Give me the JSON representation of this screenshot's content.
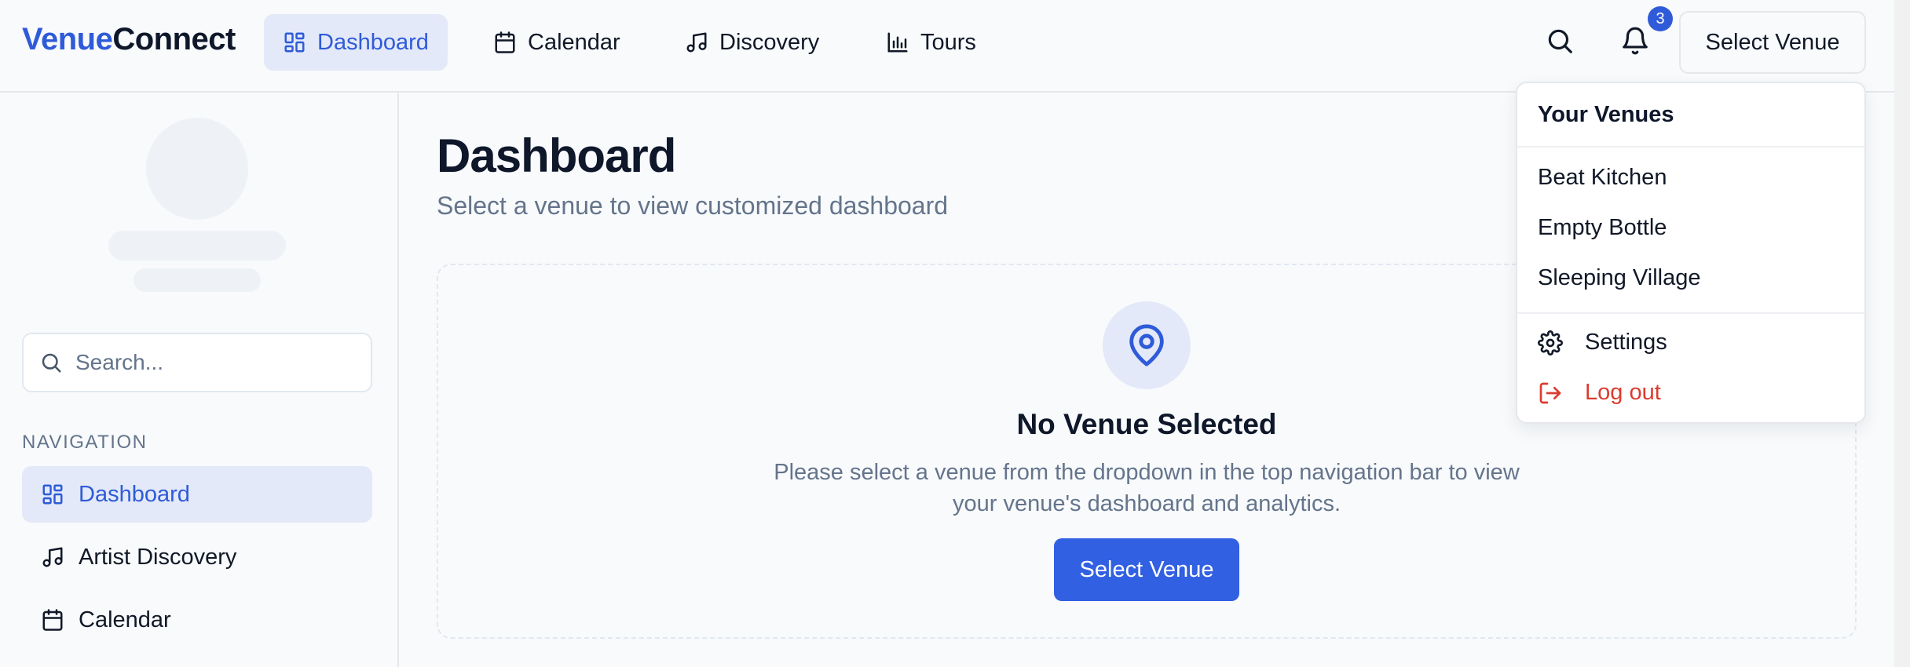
{
  "app": {
    "brand_part1": "Venue",
    "brand_part2": "Connect"
  },
  "topnav": {
    "tabs": [
      {
        "label": "Dashboard",
        "icon": "dashboard-icon",
        "active": true
      },
      {
        "label": "Calendar",
        "icon": "calendar-icon",
        "active": false
      },
      {
        "label": "Discovery",
        "icon": "music-note-icon",
        "active": false
      },
      {
        "label": "Tours",
        "icon": "bar-chart-icon",
        "active": false
      }
    ],
    "notification_count": "3",
    "select_venue_label": "Select Venue"
  },
  "dropdown": {
    "heading": "Your Venues",
    "venues": [
      "Beat Kitchen",
      "Empty Bottle",
      "Sleeping Village"
    ],
    "settings_label": "Settings",
    "logout_label": "Log out"
  },
  "sidebar": {
    "search_placeholder": "Search...",
    "nav_heading": "NAVIGATION",
    "items": [
      {
        "label": "Dashboard",
        "icon": "dashboard-icon",
        "active": true
      },
      {
        "label": "Artist Discovery",
        "icon": "music-note-icon",
        "active": false
      },
      {
        "label": "Calendar",
        "icon": "calendar-icon",
        "active": false
      }
    ]
  },
  "main": {
    "title": "Dashboard",
    "subtitle": "Select a venue to view customized dashboard",
    "empty_state": {
      "icon": "map-pin-icon",
      "title": "No Venue Selected",
      "description": "Please select a venue from the dropdown in the top navigation bar to view your venue's dashboard and analytics.",
      "button_label": "Select Venue"
    }
  },
  "colors": {
    "accent": "#3160e3",
    "accent_soft": "#e3e9f8",
    "danger": "#dc3b2f",
    "muted": "#64748b"
  }
}
